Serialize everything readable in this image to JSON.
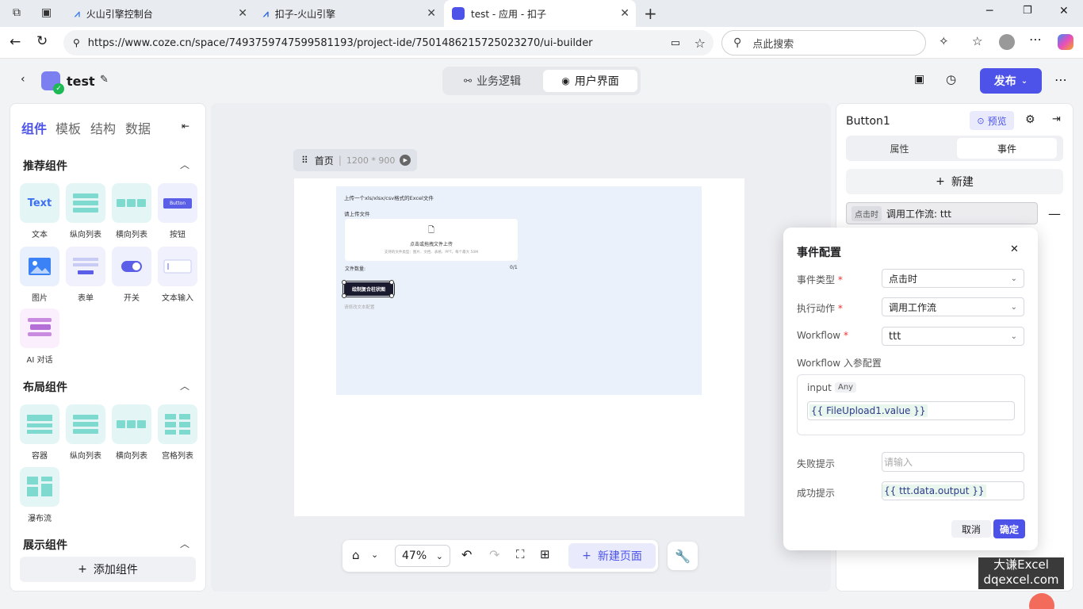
{
  "browser": {
    "tabs": [
      {
        "title": "火山引擎控制台"
      },
      {
        "title": "扣子-火山引擎"
      },
      {
        "title": "test - 应用 - 扣子"
      }
    ],
    "url": "https://www.coze.cn/space/7493759747599581193/project-ide/7501486215725023270/ui-builder",
    "search_placeholder": "点此搜索"
  },
  "app": {
    "project_name": "test",
    "mode_tabs": [
      "业务逻辑",
      "用户界面"
    ],
    "active_mode": "用户界面",
    "publish_label": "发布"
  },
  "left_panel": {
    "tabs": [
      "组件",
      "模板",
      "结构",
      "数据"
    ],
    "sections": {
      "recommended": {
        "title": "推荐组件",
        "items": [
          "文本",
          "纵向列表",
          "横向列表",
          "按钮",
          "图片",
          "表单",
          "开关",
          "文本输入",
          "AI 对话"
        ]
      },
      "layout": {
        "title": "布局组件",
        "items": [
          "容器",
          "纵向列表",
          "横向列表",
          "宫格列表",
          "瀑布流"
        ]
      },
      "display": {
        "title": "展示组件"
      }
    },
    "icon_text": "Text",
    "icon_button": "Button",
    "add_component": "添加组件"
  },
  "canvas": {
    "page_name": "首页",
    "page_size": "1200 * 900",
    "preview": {
      "heading": "上传一个xls/xlsx/csv格式的Excel文件",
      "upload_label": "请上传文件",
      "upload_hint": "点击或拖拽文件上传",
      "upload_sub": "支持的文件类型：图片、文档、表格、PPT，每个最大 50M",
      "file_count_label": "文件数量:",
      "file_count": "0/1",
      "button_text": "绘制复合柱状图",
      "placeholder_text": "请修改文本配置"
    },
    "toolbar": {
      "zoom": "47%",
      "new_page": "新建页面"
    }
  },
  "right_panel": {
    "component_name": "Button1",
    "preview_label": "预览",
    "tabs": [
      "属性",
      "事件"
    ],
    "active_tab": "事件",
    "new_label": "新建",
    "event_item": {
      "tag": "点击时",
      "text": "调用工作流: ttt"
    }
  },
  "event_config": {
    "title": "事件配置",
    "event_type_label": "事件类型",
    "event_type_value": "点击时",
    "action_label": "执行动作",
    "action_value": "调用工作流",
    "workflow_label": "Workflow",
    "workflow_value": "ttt",
    "params_label": "Workflow 入参配置",
    "param_name": "input",
    "param_type": "Any",
    "param_value": "{{ FileUpload1.value }}",
    "fail_label": "失败提示",
    "fail_placeholder": "请输入",
    "success_label": "成功提示",
    "success_value": "{{ ttt.data.output }}",
    "cancel": "取消",
    "confirm": "确定"
  },
  "watermark": {
    "line1": "大谦Excel",
    "line2": "dqexcel.com"
  },
  "colors": {
    "accent": "#4d53e8",
    "tile": "#e3f6f5",
    "canvas_bg": "#eaf1fb"
  }
}
